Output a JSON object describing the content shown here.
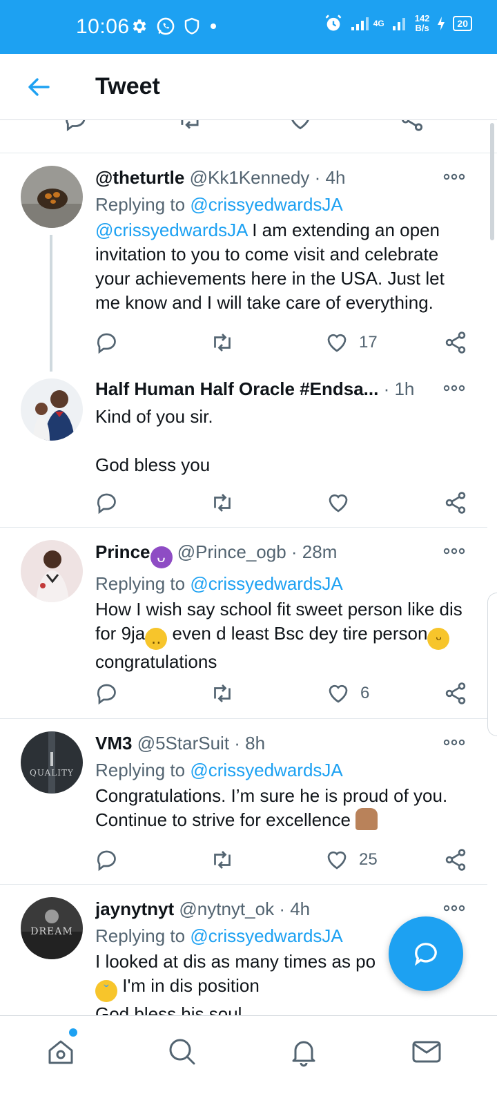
{
  "status_bar": {
    "time": "10:06",
    "network": "4G",
    "speed_value": "142",
    "speed_unit": "B/s",
    "battery": "20"
  },
  "header": {
    "title": "Tweet"
  },
  "tweets": [
    {
      "name": "@theturtle",
      "handle": "@Kk1Kennedy",
      "time": "· 4h",
      "replying_prefix": "Replying to ",
      "replying_to": "@crissyedwardsJA",
      "text_mention": "@crissyedwardsJA",
      "text": " I am extending an open invitation to you to come visit and celebrate your achievements here in the USA. Just let me know and I will take care of everything.",
      "likes": "17"
    },
    {
      "name": "Half Human Half Oracle #Endsa...",
      "time": "· 1h",
      "text_line1": "Kind of you sir.",
      "text_line2": "God bless you",
      "likes": ""
    },
    {
      "name": "Prince",
      "handle": "@Prince_ogb",
      "time": "· 28m",
      "replying_prefix": "Replying to ",
      "replying_to": "@crissyedwardsJA",
      "text_a": "How I wish say school fit sweet person like dis for 9ja",
      "text_b": " even d least Bsc dey tire person",
      "text_c": " congratulations",
      "likes": "6"
    },
    {
      "name": "VM3",
      "handle": "@5StarSuit",
      "time": "· 8h",
      "replying_prefix": "Replying to ",
      "replying_to": "@crissyedwardsJA",
      "text": "Congratulations. I’m sure he is proud of you. Continue to strive for excellence",
      "avatar_text": "QUALITY",
      "likes": "25"
    },
    {
      "name": "jaynytnyt",
      "handle": "@nytnyt_ok",
      "time": "· 4h",
      "replying_prefix": "Replying to ",
      "replying_to": "@crissyedwardsJA",
      "text_line1": "I looked at dis as many times as po",
      "text_line2": " I'm in dis position",
      "text_line3": "God bless his soul",
      "avatar_text": "DREAM"
    }
  ],
  "colors": {
    "accent": "#1DA1F2",
    "text_primary": "#0f1419",
    "text_secondary": "#536471",
    "divider": "#e3e8ec"
  },
  "icons": {
    "back": "arrow-left-icon",
    "reply": "reply-icon",
    "retweet": "retweet-icon",
    "like": "heart-icon",
    "share": "share-icon",
    "more": "more-dots-icon",
    "compose": "compose-reply-icon",
    "nav": [
      "home-icon",
      "search-icon",
      "notifications-icon",
      "messages-icon"
    ]
  }
}
